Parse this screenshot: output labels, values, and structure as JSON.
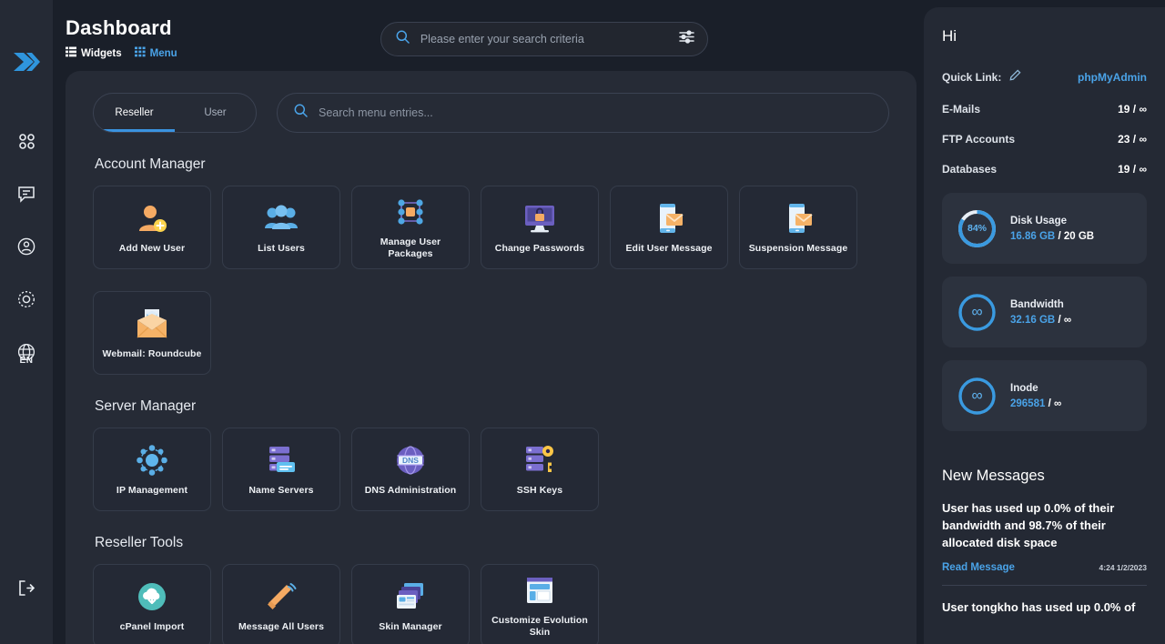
{
  "rail": {
    "logo_icon": "double-chevron-logo",
    "items": [
      {
        "icon": "apps-grid-icon",
        "name": "apps"
      },
      {
        "icon": "chat-bubble-icon",
        "name": "messages"
      },
      {
        "icon": "user-circle-icon",
        "name": "account"
      },
      {
        "icon": "gear-icon",
        "name": "settings"
      },
      {
        "icon": "globe-icon",
        "name": "language"
      }
    ],
    "language": "EN",
    "logout_icon": "logout-icon"
  },
  "header": {
    "title": "Dashboard",
    "crumbs": [
      {
        "label": "Widgets",
        "icon": "list-view-icon",
        "active": false
      },
      {
        "label": "Menu",
        "icon": "grid-view-icon",
        "active": true
      }
    ]
  },
  "top_search": {
    "value": "",
    "placeholder": "Please enter your search criteria",
    "search_icon": "search-icon",
    "filter_icon": "sliders-filter-icon"
  },
  "panel": {
    "tabs": [
      {
        "label": "Reseller",
        "active": true
      },
      {
        "label": "User",
        "active": false
      }
    ],
    "menu_search": {
      "value": "",
      "placeholder": "Search menu entries...",
      "search_icon": "search-icon"
    },
    "sections": [
      {
        "title": "Account Manager",
        "tiles": [
          {
            "label": "Add New User",
            "icon": "add-user-icon"
          },
          {
            "label": "List Users",
            "icon": "users-group-icon"
          },
          {
            "label": "Manage User Packages",
            "icon": "packages-network-icon"
          },
          {
            "label": "Change Passwords",
            "icon": "monitor-lock-icon"
          },
          {
            "label": "Edit User Message",
            "icon": "phone-envelope-icon"
          },
          {
            "label": "Suspension Message",
            "icon": "phone-envelope-icon"
          },
          {
            "label": "Webmail: Roundcube",
            "icon": "envelope-cube-icon"
          }
        ]
      },
      {
        "title": "Server Manager",
        "tiles": [
          {
            "label": "IP Management",
            "icon": "network-nodes-icon"
          },
          {
            "label": "Name Servers",
            "icon": "server-stack-icon"
          },
          {
            "label": "DNS Administration",
            "icon": "dns-globe-icon"
          },
          {
            "label": "SSH Keys",
            "icon": "server-key-icon"
          }
        ]
      },
      {
        "title": "Reseller Tools",
        "tiles": [
          {
            "label": "cPanel Import",
            "icon": "cloud-download-icon"
          },
          {
            "label": "Message All Users",
            "icon": "megaphone-icon"
          },
          {
            "label": "Skin Manager",
            "icon": "skin-layers-icon"
          },
          {
            "label": "Customize Evolution Skin",
            "icon": "layout-window-icon"
          }
        ]
      }
    ]
  },
  "right": {
    "greeting": "Hi",
    "quick_link": {
      "label": "Quick Link:",
      "edit_icon": "pencil-icon",
      "value": "phpMyAdmin"
    },
    "stats": [
      {
        "name": "E-Mails",
        "value": "19 / ∞"
      },
      {
        "name": "FTP Accounts",
        "value": "23 / ∞"
      },
      {
        "name": "Databases",
        "value": "19 / ∞"
      }
    ],
    "usage": [
      {
        "title": "Disk Usage",
        "ring_label": "84%",
        "percent": 84,
        "used": "16.86 GB",
        "separator": "/",
        "total": "20 GB",
        "infinite": false
      },
      {
        "title": "Bandwidth",
        "ring_label": "∞",
        "percent": 100,
        "used": "32.16 GB",
        "separator": "/",
        "total": "∞",
        "infinite": true
      },
      {
        "title": "Inode",
        "ring_label": "∞",
        "percent": 100,
        "used": "296581",
        "separator": "/",
        "total": "∞",
        "infinite": true
      }
    ],
    "messages_title": "New Messages",
    "messages": [
      {
        "body": "User            has used up 0.0% of their bandwidth and 98.7% of their allocated disk space",
        "link": "Read Message",
        "date": "4:24 1/2/2023"
      },
      {
        "body": "User tongkho has used up 0.0% of",
        "link": "",
        "date": ""
      }
    ]
  },
  "colors": {
    "accent": "#4aa3e8",
    "page_bg": "#1a1f29",
    "panel_bg": "#262b36",
    "tile_bg": "#242935",
    "right_bg": "#242934"
  }
}
